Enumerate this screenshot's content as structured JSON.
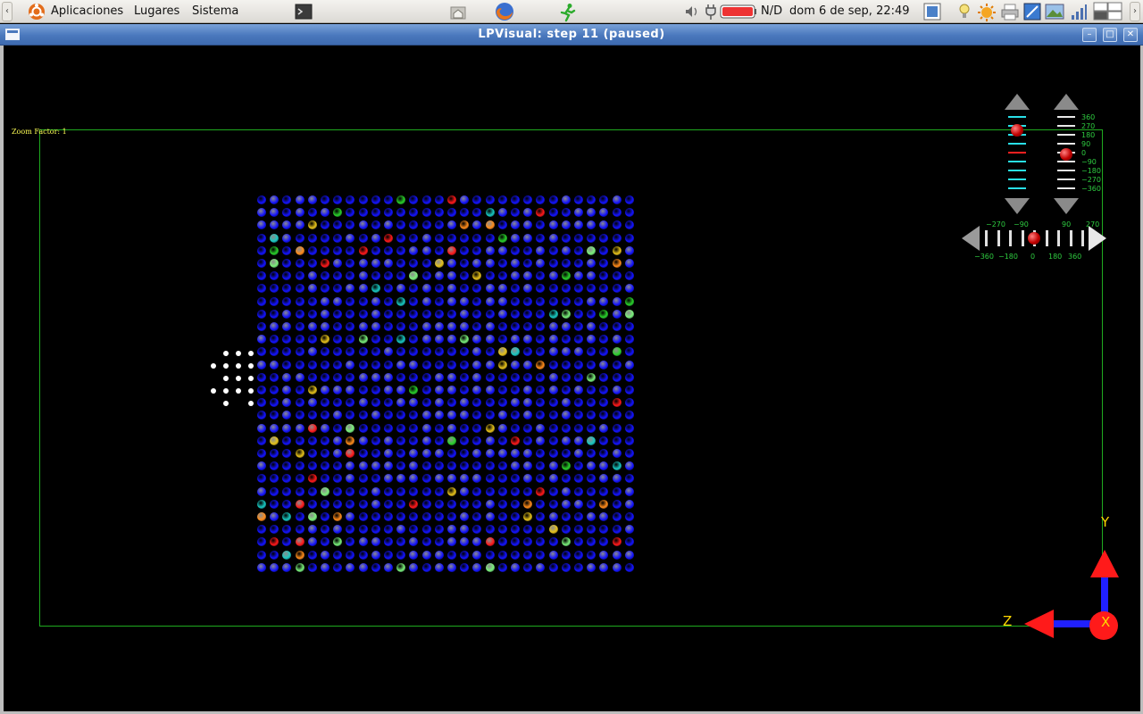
{
  "panel": {
    "menus": [
      "Aplicaciones",
      "Lugares",
      "Sistema"
    ],
    "battery": "N/D",
    "clock": "dom   6 de sep, 22:49"
  },
  "window": {
    "title": "LPVisual: step 11 (paused)"
  },
  "viewer": {
    "zoom_label": "Zoom Factor: 1",
    "vertical_scale": [
      "360",
      "270",
      "180",
      "90",
      "0",
      "−90",
      "−180",
      "−270",
      "−360"
    ],
    "horizontal_top_labels": [
      "−270",
      "−90",
      "90",
      "270"
    ],
    "horizontal_bottom_labels": [
      "−360",
      "−180",
      "0",
      "180",
      "360"
    ],
    "axis_labels": {
      "y": "Y",
      "z": "Z",
      "x": "X"
    },
    "grid_rows": 30,
    "grid_cols": 30,
    "highlight_colors": [
      "#ff1a1a",
      "#2ad12a",
      "#19c8c0",
      "#e6c21a",
      "#ff8c1a",
      "#7af07a"
    ],
    "base_color": "#1414ff",
    "frame_color": "#1faa1f"
  }
}
